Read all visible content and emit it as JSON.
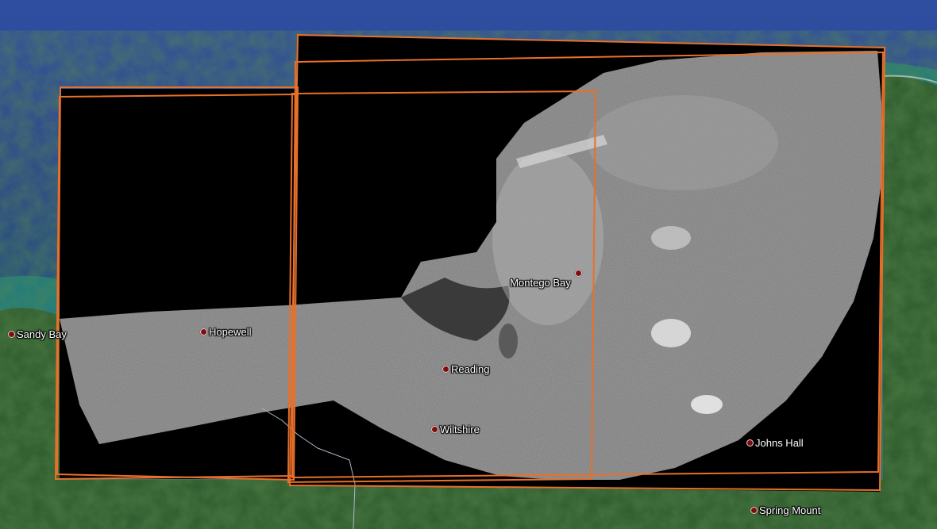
{
  "map": {
    "colors": {
      "ocean_deep": "#23408a",
      "ocean_shallow": "#1e5a78",
      "land": "#2e5a2c",
      "imagery_gray": "#8a8a8a",
      "imagery_mask": "#000000",
      "footprint_outline": "#e8702a",
      "boundary_line": "#a8b6c6",
      "place_pin": "#7a0f12"
    },
    "places": [
      {
        "id": "sandy-bay",
        "label": "Sandy Bay"
      },
      {
        "id": "hopewell",
        "label": "Hopewell"
      },
      {
        "id": "montego-bay",
        "label": "Montego Bay"
      },
      {
        "id": "reading",
        "label": "Reading"
      },
      {
        "id": "wiltshire",
        "label": "Wiltshire"
      },
      {
        "id": "johns-hall",
        "label": "Johns Hall"
      },
      {
        "id": "spring-mount",
        "label": "Spring Mount"
      }
    ]
  }
}
